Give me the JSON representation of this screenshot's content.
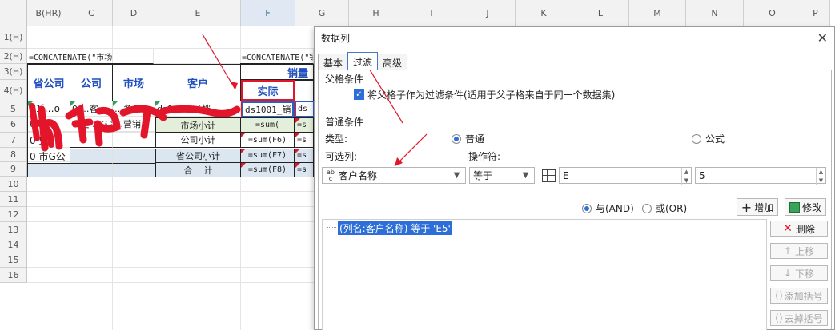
{
  "spreadsheet": {
    "columns": [
      {
        "label": "B(HR)",
        "selected": false
      },
      {
        "label": "C",
        "selected": false
      },
      {
        "label": "D",
        "selected": false
      },
      {
        "label": "E",
        "selected": false
      },
      {
        "label": "F",
        "selected": true
      },
      {
        "label": "G",
        "selected": false
      },
      {
        "label": "H",
        "selected": false
      },
      {
        "label": "I",
        "selected": false
      },
      {
        "label": "J",
        "selected": false
      },
      {
        "label": "K",
        "selected": false
      },
      {
        "label": "L",
        "selected": false
      },
      {
        "label": "M",
        "selected": false
      },
      {
        "label": "N",
        "selected": false
      },
      {
        "label": "O",
        "selected": false
      },
      {
        "label": "P",
        "selected": false
      }
    ],
    "rows": [
      "1(H)",
      "2(H)",
      "3(H)",
      "4(H)",
      "5",
      "6",
      "7",
      "8",
      "9",
      "10",
      "11",
      "12",
      "13",
      "14",
      "15",
      "16"
    ],
    "cells": {
      "b2": "=CONCATENATE(\"市场",
      "f2": "=CONCATENATE(\"销",
      "g3": "销量",
      "b3": "省公司",
      "c3": "公司",
      "d3": "市场",
      "e3": "客户",
      "f4": "实际",
      "b5": "d1i…o",
      "b5b": "s 1 …",
      "b6": "0.",
      "b7": "0 史.",
      "b8": "0 市G公",
      "c5": "0 …客.",
      "c6": "1 史 …G 销",
      "d5": "…条C",
      "d6": "…营销.",
      "e5": "ds0… …场档",
      "f5": "ds1001_销",
      "g5": "ds",
      "e6": "市场小计",
      "f6": "=sum(",
      "e7": "公司小计",
      "f7": "=sum(F6)",
      "e8": "省公司小计",
      "f8": "=sum(F7)",
      "e9": "合    计",
      "f9": "=sum(F8)",
      "g6": "=s",
      "g7": "=s",
      "g8": "=s",
      "g9": "=s"
    }
  },
  "dialog": {
    "title": "数据列",
    "close_icon": "close-icon",
    "tabs": [
      {
        "label": "基本",
        "active": false
      },
      {
        "label": "过滤",
        "active": true
      },
      {
        "label": "高级",
        "active": false
      }
    ],
    "parent_section": "父格条件",
    "parent_checkbox_label": "将父格子作为过滤条件(适用于父子格来自于同一个数据集)",
    "parent_checkbox_checked": true,
    "common_section": "普通条件",
    "type_label": "类型:",
    "type_options": [
      {
        "label": "普通",
        "selected": true
      },
      {
        "label": "公式",
        "selected": false
      }
    ],
    "column_label": "可选列:",
    "column_value": "客户名称",
    "column_icon": "abc-field-icon",
    "operator_label": "操作符:",
    "operator_value": "等于",
    "value_type_icon": "table-grid-icon",
    "value_text": "E",
    "value_number": "5",
    "logic_options": [
      {
        "label": "与(AND)",
        "selected": true
      },
      {
        "label": "或(OR)",
        "selected": false
      }
    ],
    "add_button": "增加",
    "modify_button": "修改",
    "condition_item": "(列名:客户名称) 等于 'E5'",
    "side_buttons": {
      "delete": "删除",
      "move_up": "上移",
      "move_down": "下移",
      "add_bracket": "添加括号",
      "remove_bracket": "去掉括号"
    }
  },
  "colors": {
    "header_blue": "#1f4fbf",
    "subtotal_green": "#e3efda",
    "subtotal_blue": "#dce6f1",
    "annotation_red": "#e3152b",
    "selection_blue": "#2d6fd6"
  }
}
